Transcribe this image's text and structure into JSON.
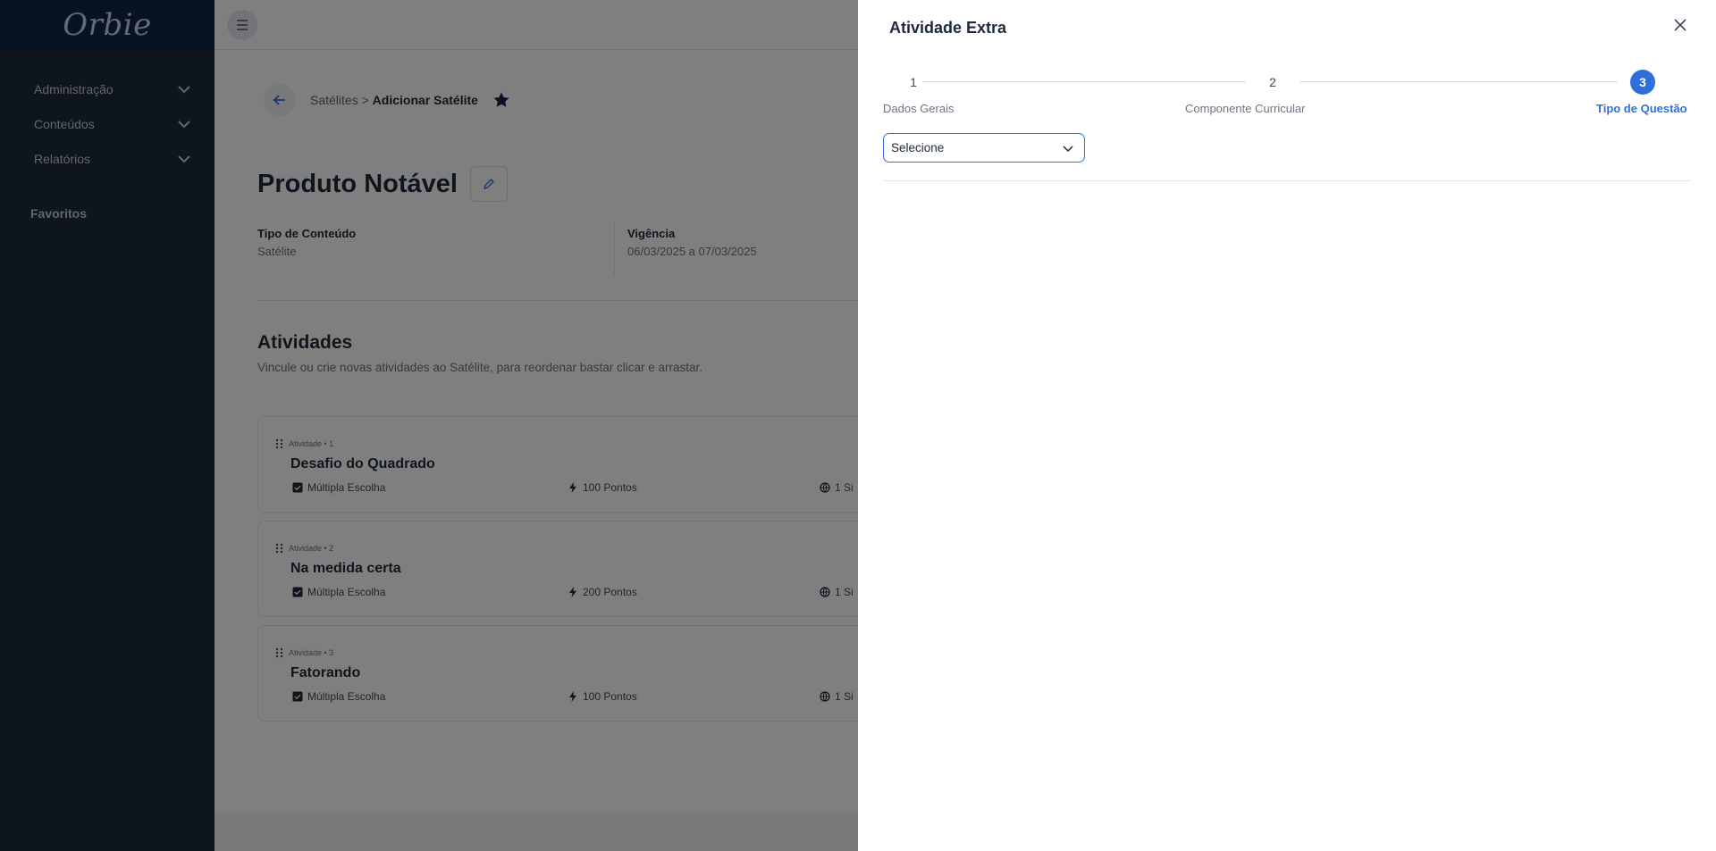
{
  "app": {
    "logo": "Orbie"
  },
  "sidebar": {
    "items": [
      {
        "label": "Administração"
      },
      {
        "label": "Conteúdos"
      },
      {
        "label": "Relatórios"
      }
    ],
    "favorites_label": "Favoritos"
  },
  "breadcrumb": {
    "parent": "Satélites",
    "separator": ">",
    "current": "Adicionar Satélite"
  },
  "page": {
    "title": "Produto Notável",
    "info": {
      "content_type_label": "Tipo de Conteúdo",
      "content_type_value": "Satélite",
      "validity_label": "Vigência",
      "validity_value": "06/03/2025 a 07/03/2025"
    },
    "activities": {
      "title": "Atividades",
      "subtitle": "Vincule ou crie novas atividades ao Satélite, para reordenar bastar clicar e arrastar.",
      "cards": [
        {
          "tag": "Atividade • 1",
          "title": "Desafio do Quadrado",
          "type": "Múltipla Escolha",
          "points": "100 Pontos",
          "extra": "1 Si"
        },
        {
          "tag": "Atividade • 2",
          "title": "Na medida certa",
          "type": "Múltipla Escolha",
          "points": "200 Pontos",
          "extra": "1 Si"
        },
        {
          "tag": "Atividade • 3",
          "title": "Fatorando",
          "type": "Múltipla Escolha",
          "points": "100 Pontos",
          "extra": "1 Si"
        }
      ]
    }
  },
  "drawer": {
    "title": "Atividade Extra",
    "steps": [
      {
        "number": "1",
        "label": "Dados Gerais"
      },
      {
        "number": "2",
        "label": "Componente Curricular"
      },
      {
        "number": "3",
        "label": "Tipo de Questão"
      }
    ],
    "active_step": 3,
    "select": {
      "value": "Selecione"
    }
  },
  "colors": {
    "primary": "#2f6fdb",
    "sidebar": "#1e2a3b",
    "logo_bar": "#0f2744"
  }
}
